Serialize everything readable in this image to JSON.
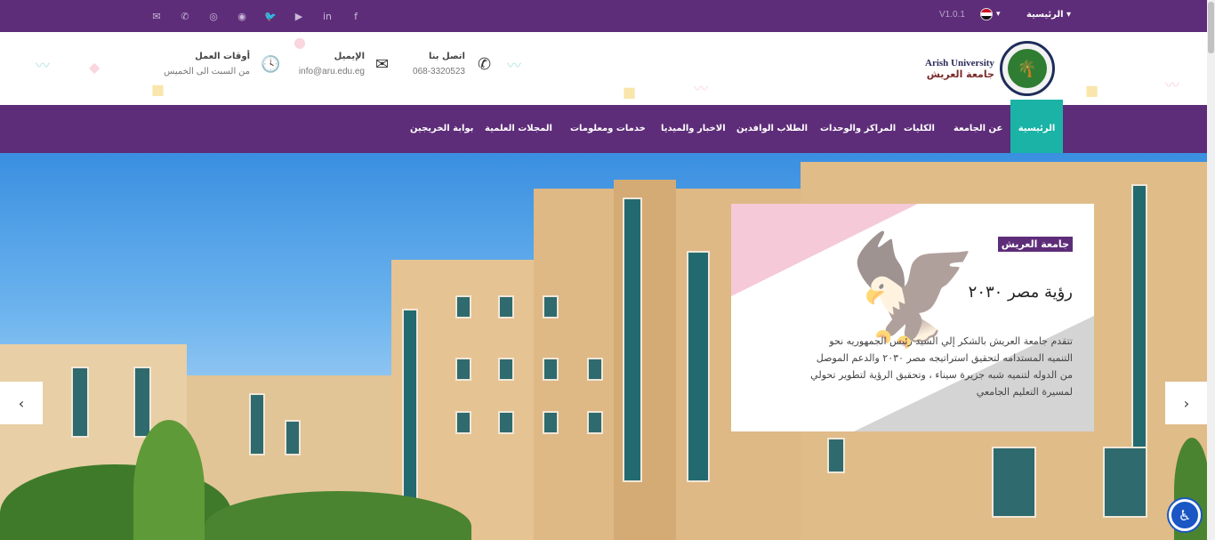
{
  "topbar": {
    "version": "V1.0.1",
    "home_dropdown": "الرئيسية ▾",
    "lang_caret": "▾",
    "social_icons": [
      "email-icon",
      "phone-icon",
      "instagram-icon",
      "whatsapp-icon",
      "twitter-icon",
      "youtube-icon",
      "linkedin-icon",
      "facebook-icon"
    ]
  },
  "header": {
    "logo_en": "Arish University",
    "logo_ar": "جامعة العريش",
    "contact": {
      "title": "اتصل بنا",
      "value": "068-3320523"
    },
    "email": {
      "title": "الإيميل",
      "value": "info@aru.edu.eg"
    },
    "hours": {
      "title": "أوقات العمل",
      "value": "من السبت الى الخميس"
    }
  },
  "nav": {
    "items": [
      {
        "label": "الرئيسية"
      },
      {
        "label": "عن الجامعة"
      },
      {
        "label": "الكليات"
      },
      {
        "label": "المراكز والوحدات"
      },
      {
        "label": "الطلاب الوافدين"
      },
      {
        "label": "الاخبار والميديا"
      },
      {
        "label": "خدمات ومعلومات"
      },
      {
        "label": "المجلات العلمية"
      },
      {
        "label": "بوابة الخريجين"
      }
    ]
  },
  "hero": {
    "badge": "جامعة العريش",
    "title": "رؤية مصر ٢٠٣٠",
    "description": "تتقدم جامعة العريش بالشكر إلي السيد رئيس الجمهوريه نحو التنميه المستدامه لتحقيق استراتيجه مصر ٢٠٣٠ والدعم الموصل من الدوله لتنميه شبه جزيرة سيناء ، وتحقيق الرؤية لتطوير تحولي لمسيرة التعليم الجامعي",
    "prev_arrow": "‹",
    "next_arrow": "›"
  },
  "colors": {
    "brand": "#5e2d79",
    "accent": "#1ab3a6"
  }
}
